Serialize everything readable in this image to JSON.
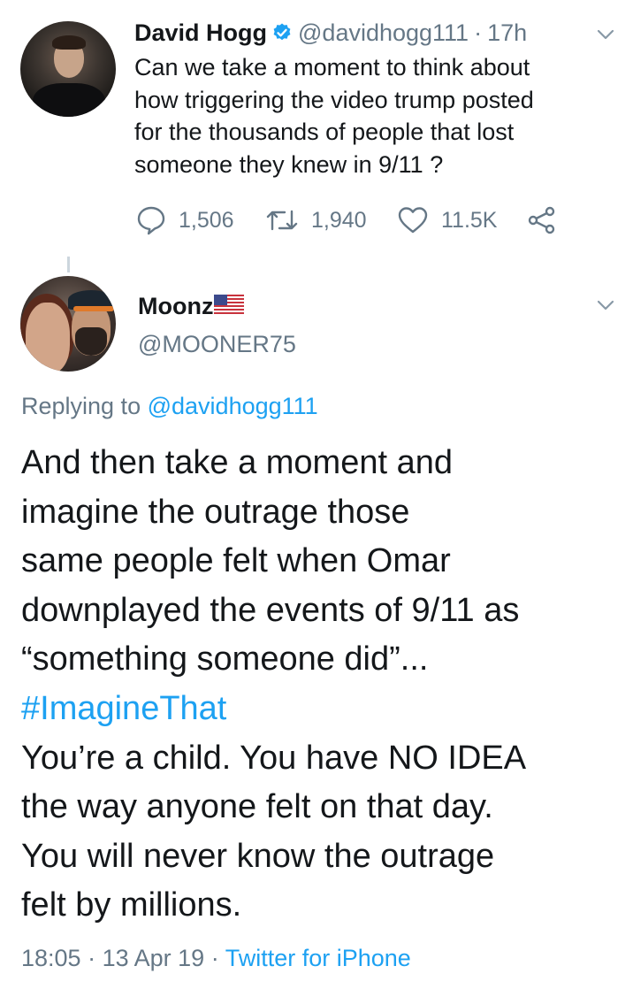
{
  "parent_tweet": {
    "author_name": "David Hogg",
    "handle": "@davidhogg111",
    "separator": "·",
    "time": "17h",
    "text_lines": [
      "Can we take a moment to think about",
      "how triggering the video trump posted",
      "for the thousands of people that lost",
      "someone they knew in 9/11 ?"
    ],
    "replies": "1,506",
    "retweets": "1,940",
    "likes": "11.5K"
  },
  "reply_tweet": {
    "author_name": "Moonz",
    "handle": "@MOONER75",
    "replying_label": "Replying to",
    "replying_to": "@davidhogg111",
    "text_lines": [
      "And then take a moment and",
      "imagine the outrage those",
      "same people felt when Omar",
      "downplayed the events of 9/11 as",
      "“something someone did”...",
      "#ImagineThat",
      "You’re a child. You have NO IDEA",
      "the way anyone felt on that day.",
      "You will never know the outrage",
      "felt by millions."
    ],
    "time": "18:05",
    "date": "13 Apr 19",
    "separator": "·",
    "source": "Twitter for iPhone"
  },
  "colors": {
    "text": "#14171a",
    "secondary": "#657786",
    "link": "#1da1f2",
    "verified": "#1da1f2",
    "divider": "#ccd6dd"
  },
  "icons": [
    "verified-badge-icon",
    "chevron-down-icon",
    "reply-icon",
    "retweet-icon",
    "like-icon",
    "share-icon",
    "us-flag-icon"
  ]
}
